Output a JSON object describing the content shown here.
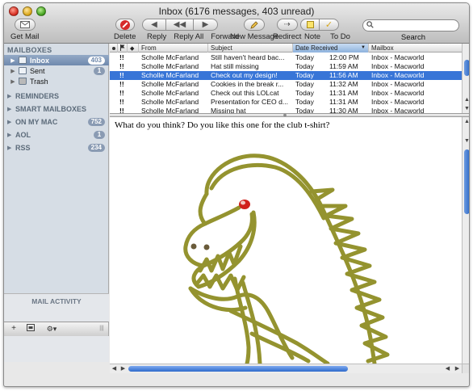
{
  "window": {
    "title": "Inbox (6176 messages, 403 unread)"
  },
  "toolbar": {
    "get_mail": "Get Mail",
    "delete": "Delete",
    "reply": "Reply",
    "reply_all": "Reply All",
    "forward": "Forward",
    "new_message": "New Message",
    "redirect": "Redirect",
    "note": "Note",
    "todo": "To Do",
    "search_label": "Search",
    "search_value": ""
  },
  "sidebar": {
    "mailboxes_header": "MAILBOXES",
    "items": [
      {
        "label": "Inbox",
        "badge": "403",
        "icon": "inbox-icon"
      },
      {
        "label": "Sent",
        "badge": "1",
        "icon": "sent-icon"
      },
      {
        "label": "Trash",
        "badge": "",
        "icon": "trash-icon"
      }
    ],
    "groups": [
      {
        "label": "REMINDERS",
        "badge": ""
      },
      {
        "label": "SMART MAILBOXES",
        "badge": ""
      },
      {
        "label": "ON MY MAC",
        "badge": "752"
      },
      {
        "label": "AOL",
        "badge": "1"
      },
      {
        "label": "RSS",
        "badge": "234"
      }
    ],
    "activity_title": "MAIL ACTIVITY",
    "add_label": "+",
    "gear_label": "⚙▾",
    "grip_label": "|||"
  },
  "message_list": {
    "columns": [
      "",
      "",
      "",
      "From",
      "Subject",
      "Date Received",
      "Mailbox"
    ],
    "sort_column": "Date Received",
    "rows": [
      {
        "flag": "!!",
        "from": "Scholle McFarland",
        "subject": "Still haven't heard bac...",
        "date": "Today",
        "time": "12:00 PM",
        "mailbox": "Inbox - Macworld"
      },
      {
        "flag": "!!",
        "from": "Scholle McFarland",
        "subject": "Hat still missing",
        "date": "Today",
        "time": "11:59 AM",
        "mailbox": "Inbox - Macworld"
      },
      {
        "flag": "!!",
        "from": "Scholle McFarland",
        "subject": "Check out my design!",
        "date": "Today",
        "time": "11:56 AM",
        "mailbox": "Inbox - Macworld"
      },
      {
        "flag": "!!",
        "from": "Scholle McFarland",
        "subject": "Cookies in the break r...",
        "date": "Today",
        "time": "11:32 AM",
        "mailbox": "Inbox - Macworld"
      },
      {
        "flag": "!!",
        "from": "Scholle McFarland",
        "subject": "Check out this LOLcat",
        "date": "Today",
        "time": "11:31 AM",
        "mailbox": "Inbox - Macworld"
      },
      {
        "flag": "!!",
        "from": "Scholle McFarland",
        "subject": "Presentation for CEO d...",
        "date": "Today",
        "time": "11:31 AM",
        "mailbox": "Inbox - Macworld"
      },
      {
        "flag": "!!",
        "from": "Scholle McFarland",
        "subject": "Missing hat",
        "date": "Today",
        "time": "11:30 AM",
        "mailbox": "Inbox - Macworld"
      }
    ],
    "selected_index": 2
  },
  "preview": {
    "body_text": "What do you think? Do you like this one for the club t-shirt?"
  },
  "colors": {
    "selection": "#3875d7",
    "sidebar_bg": "#d6dde5",
    "drawing_stroke": "#8c8a1e",
    "eye_red": "#d0201a"
  }
}
